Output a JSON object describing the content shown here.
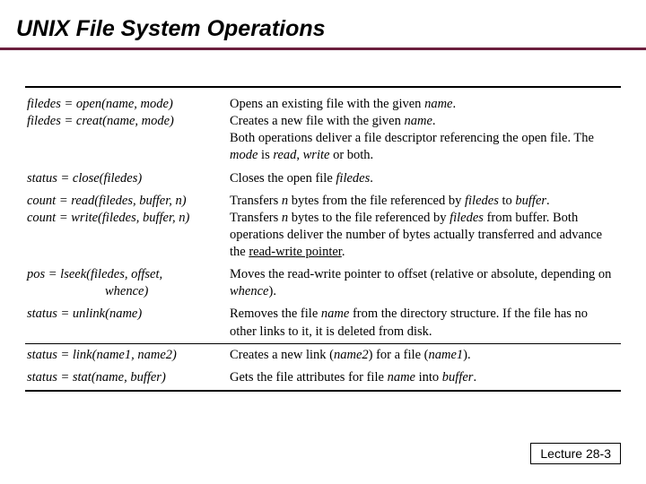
{
  "title": "UNIX File System Operations",
  "rows": {
    "r1_left_a": "filedes = open(name, mode)",
    "r1_left_b": "filedes = creat(name, mode)",
    "r1_right": "Opens an existing file with the given <span class='ital'>name</span>.<br>Creates a new file with the given <span class='ital'>name</span>.<br>Both operations deliver a file descriptor referencing the open file. The <span class='ital'>mode</span> is <span class='ital'>read</span>, <span class='ital'>write</span> or both.",
    "r2_left": "status = close(filedes)",
    "r2_right": "Closes the open file <span class='ital'>filedes</span>.",
    "r3_left_a": "count = read(filedes, buffer, n)",
    "r3_left_b": "count = write(filedes, buffer, n)",
    "r3_right": "Transfers <span class='ital'>n</span> bytes from the file referenced by <span class='ital'>filedes</span> to <span class='ital'>buffer</span>.<br>Transfers <span class='ital'>n</span> bytes to the file referenced by <span class='ital'>filedes</span> from buffer. Both operations deliver the number of bytes actually transferred and advance the <span class='u'>read-write pointer</span>.",
    "r4_left": "pos = lseek(filedes, offset,<br>&nbsp;&nbsp;&nbsp;&nbsp;&nbsp;&nbsp;&nbsp;&nbsp;&nbsp;&nbsp;&nbsp;&nbsp;&nbsp;&nbsp;&nbsp;&nbsp;&nbsp;&nbsp;&nbsp;&nbsp;&nbsp;&nbsp;&nbsp;&nbsp;whence)",
    "r4_right": "Moves the read-write pointer to offset (relative or absolute, depending on <span class='ital'>whence</span>).",
    "r5_left": "status = unlink(name)",
    "r5_right": "Removes the file <span class='ital'>name</span> from the directory structure. If the file has no other links to it, it is deleted from disk.",
    "r6_left": "status = link(name1, name2)",
    "r6_right": "Creates a new link (<span class='ital'>name2</span>) for a file (<span class='ital'>name1</span>).",
    "r7_left": "status = stat(name, buffer)",
    "r7_right": "Gets the file attributes for file <span class='ital'>name</span> into <span class='ital'>buffer</span>."
  },
  "footer": "Lecture 28-3"
}
